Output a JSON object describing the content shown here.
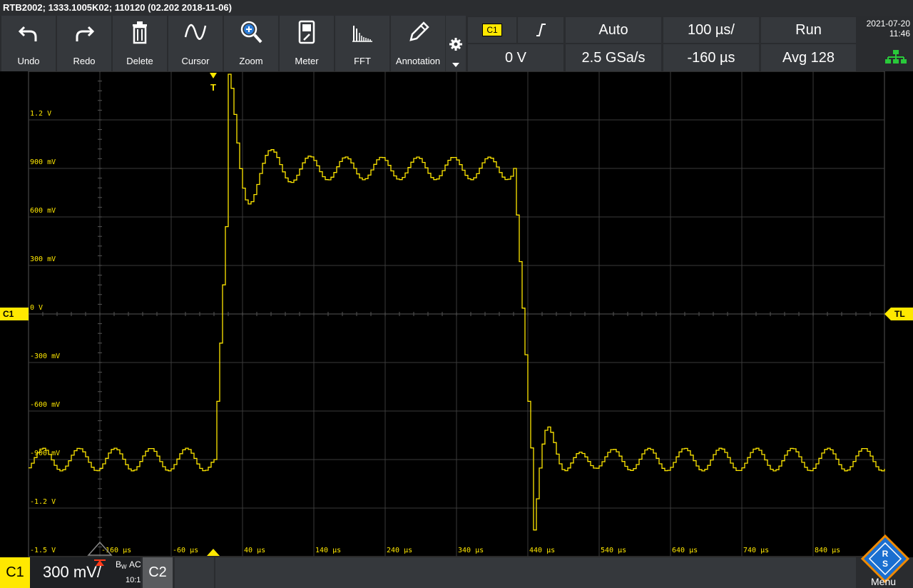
{
  "title": "RTB2002; 1333.1005K02; 110120 (02.202 2018-11-06)",
  "toolbar": {
    "undo": "Undo",
    "redo": "Redo",
    "delete": "Delete",
    "cursor": "Cursor",
    "zoom": "Zoom",
    "meter": "Meter",
    "fft": "FFT",
    "annotation": "Annotation"
  },
  "trigger": {
    "source": "C1",
    "mode": "Auto",
    "timebase": "100 µs/",
    "run_state": "Run",
    "level": "0 V",
    "sample_rate": "2.5 GSa/s",
    "position": "-160 µs",
    "acquire": "Avg 128"
  },
  "clock": {
    "date": "2021-07-20",
    "time": "11:46"
  },
  "channel1": {
    "marker": "C1",
    "trigger_level_marker": "TL",
    "scale": "300 mV/",
    "bandwidth": "B",
    "bandwidth_sub": "W",
    "coupling": "AC",
    "probe": "10:1",
    "color": "#ffe800"
  },
  "channel2": {
    "label": "C2"
  },
  "brand_menu": "Menu",
  "y_ticks": [
    "1.2 V",
    "900 mV",
    "600 mV",
    "300 mV",
    "0 V",
    "-300 mV",
    "-600 mV",
    "-900 mV",
    "-1.2 V",
    "-1.5 V"
  ],
  "x_ticks": [
    "-160 µs",
    "-60 µs",
    "40 µs",
    "140 µs",
    "240 µs",
    "340 µs",
    "440 µs",
    "540 µs",
    "640 µs",
    "740 µs",
    "840 µs"
  ],
  "trigger_marker": "T"
}
